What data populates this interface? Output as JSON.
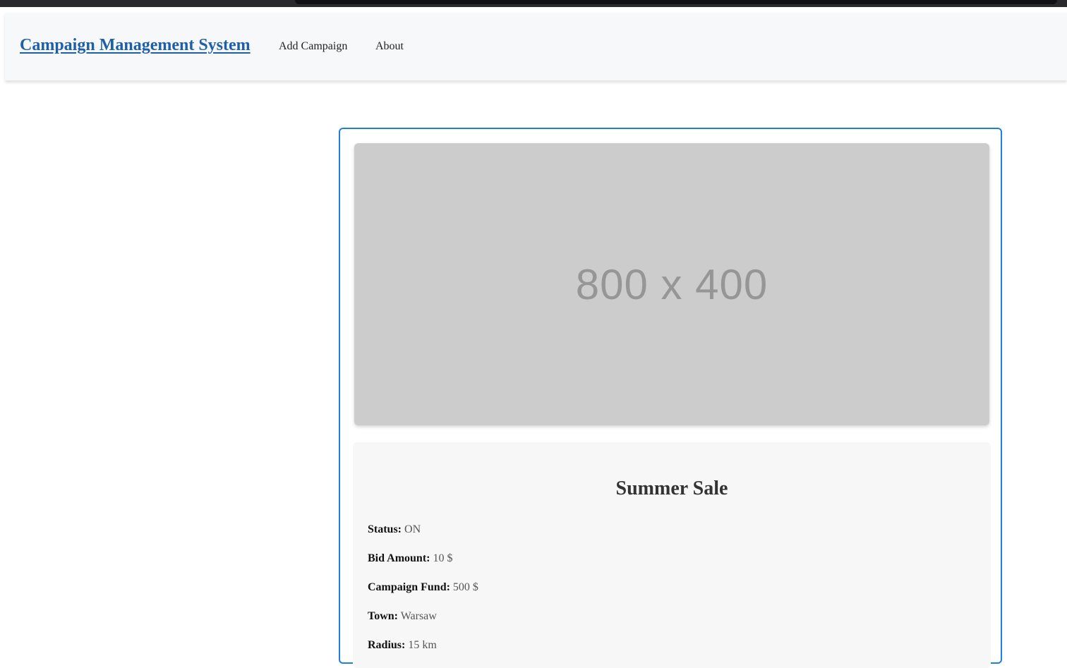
{
  "navbar": {
    "brand": "Campaign Management System",
    "links": [
      "Add Campaign",
      "About"
    ]
  },
  "campaign": {
    "image_placeholder": "800 x 400",
    "title": "Summer Sale",
    "fields": [
      {
        "label": "Status:",
        "value": "ON"
      },
      {
        "label": "Bid Amount:",
        "value": "10 $"
      },
      {
        "label": "Campaign Fund:",
        "value": "500 $"
      },
      {
        "label": "Town:",
        "value": "Warsaw"
      },
      {
        "label": "Radius:",
        "value": "15 km"
      }
    ]
  },
  "colors": {
    "brand": "#1f5fa8",
    "card_border": "#1e7fe0",
    "placeholder_bg": "#cccccc",
    "navbar_bg": "#f7f8fa"
  }
}
